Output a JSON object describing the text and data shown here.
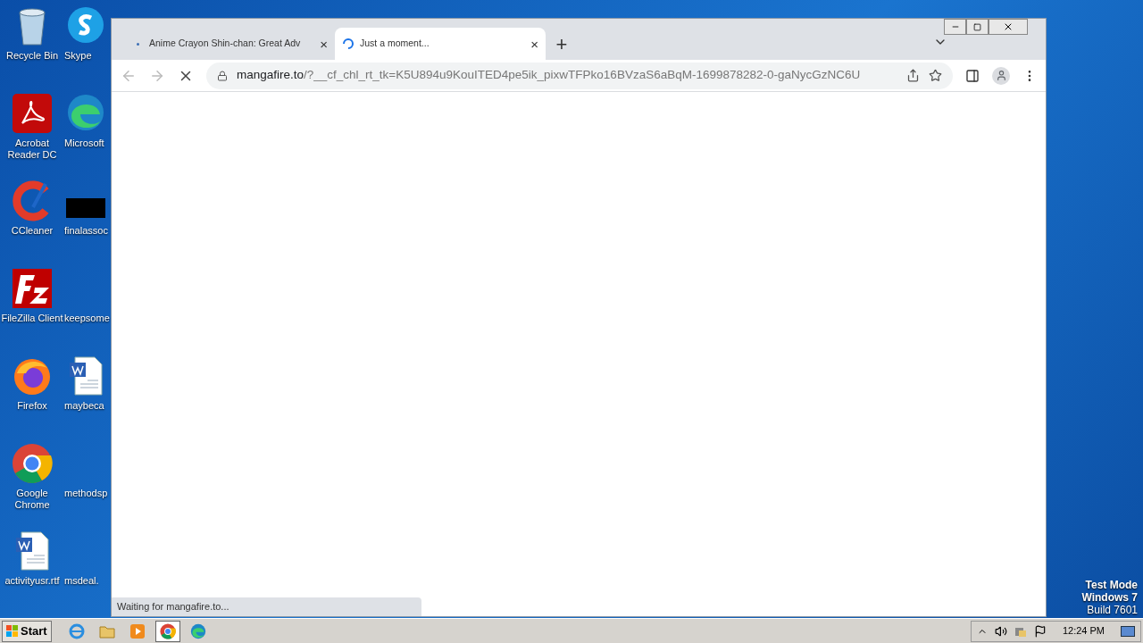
{
  "desktop": {
    "icons": [
      {
        "label": "Recycle Bin",
        "kind": "bin"
      },
      {
        "label": "Skype",
        "kind": "skype"
      },
      {
        "label": "Acrobat Reader DC",
        "kind": "acrobat"
      },
      {
        "label": "Microsoft",
        "kind": "edge"
      },
      {
        "label": "CCleaner",
        "kind": "ccleaner"
      },
      {
        "label": "finalassoc",
        "kind": "black"
      },
      {
        "label": "FileZilla Client",
        "kind": "filezilla"
      },
      {
        "label": "keepsome",
        "kind": "blank"
      },
      {
        "label": "Firefox",
        "kind": "firefox"
      },
      {
        "label": "maybeca",
        "kind": "word"
      },
      {
        "label": "Google Chrome",
        "kind": "chrome"
      },
      {
        "label": "methodsp",
        "kind": "blank"
      },
      {
        "label": "activityusr.rtf",
        "kind": "word"
      },
      {
        "label": "msdeal.",
        "kind": "blank"
      }
    ],
    "watermark": [
      "Test Mode",
      "Windows 7",
      "Build 7601"
    ]
  },
  "browser": {
    "tabs": [
      {
        "title": "Anime Crayon Shin-chan: Great Adv",
        "selected": false,
        "loading": false,
        "close": "×"
      },
      {
        "title": "Just a moment...",
        "selected": true,
        "loading": true,
        "close": "×"
      }
    ],
    "new_tab": "+",
    "url_host": "mangafire.to",
    "url_rest": "/?__cf_chl_rt_tk=K5U894u9KouITED4pe5ik_pixwTFPko16BVzaS6aBqM-1699878282-0-gaNycGzNC6U",
    "status": "Waiting for mangafire.to..."
  },
  "taskbar": {
    "start": "Start",
    "apps": [
      {
        "kind": "ie",
        "selected": false
      },
      {
        "kind": "folder",
        "selected": false
      },
      {
        "kind": "media",
        "selected": false
      },
      {
        "kind": "chrome",
        "selected": true
      },
      {
        "kind": "edge",
        "selected": false
      }
    ],
    "clock": "12:24 PM"
  }
}
